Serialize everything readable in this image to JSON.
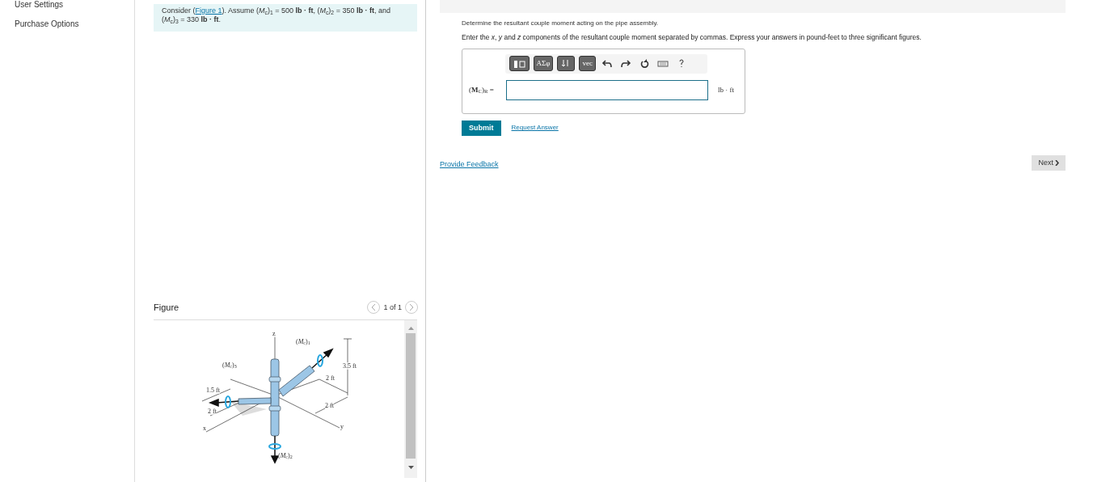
{
  "sidebar": {
    "items": [
      {
        "label": "User Settings"
      },
      {
        "label": "Purchase Options"
      }
    ]
  },
  "problem": {
    "prefix": "Consider (",
    "link": "Figure 1",
    "suffix": "). Assume (*M*$_{c}$)$_{1}$ = 500 **lb · ft**, (*M*$_{c}$)$_{2}$ = 350 **lb · ft**, and (*M*$_{c}$)$_{3}$ = 330 **lb · ft**."
  },
  "figure": {
    "title": "Figure",
    "pager": "1 of 1",
    "labels": [
      "z",
      "(*M*$_{c}$)$_{1}$",
      "(*M*$_{c}$)$_{3}$",
      "3.5 ft",
      "2 ft",
      "1.5 ft",
      "2 ft",
      "2 ft",
      "x",
      "y",
      "(*M*$_{c}$)$_{2}$"
    ]
  },
  "question": {
    "intro": "Determine the resultant couple moment acting on the pipe assembly.",
    "instruction": "Enter the *x*, *y* and *z* components of the resultant couple moment separated by commas. Express your answers in pound-feet to three significant figures.",
    "toolbar": [
      {
        "kind": "template"
      },
      {
        "kind": "text",
        "label": "ΑΣφ"
      },
      {
        "kind": "sort"
      },
      {
        "kind": "text",
        "label": "vec"
      },
      {
        "kind": "undo"
      },
      {
        "kind": "redo"
      },
      {
        "kind": "reset"
      },
      {
        "kind": "keyboard"
      },
      {
        "kind": "help"
      }
    ],
    "answer_label": "(**M**$_{C}$)$_{R}$ =",
    "unit": "lb · ft",
    "submit": "Submit",
    "request": "Request Answer"
  },
  "feedback": "Provide Feedback",
  "next": "Next"
}
